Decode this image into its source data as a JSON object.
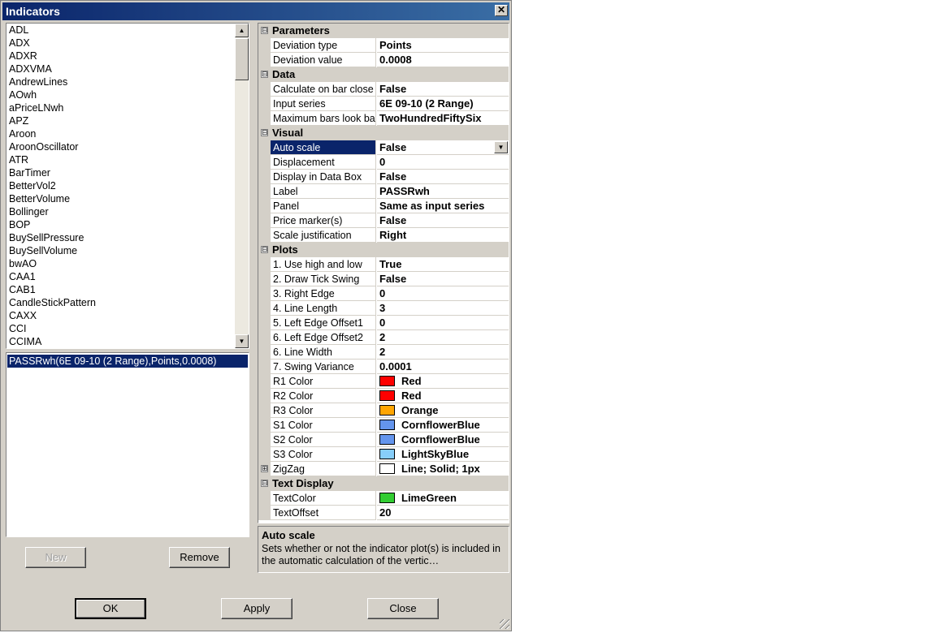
{
  "window": {
    "title": "Indicators",
    "close_glyph": "✕"
  },
  "indicator_list": {
    "items": [
      "ADL",
      "ADX",
      "ADXR",
      "ADXVMA",
      "AndrewLines",
      "AOwh",
      "aPriceLNwh",
      "APZ",
      "Aroon",
      "AroonOscillator",
      "ATR",
      "BarTimer",
      "BetterVol2",
      "BetterVolume",
      "Bollinger",
      "BOP",
      "BuySellPressure",
      "BuySellVolume",
      "bwAO",
      "CAA1",
      "CAB1",
      "CandleStickPattern",
      "CAXX",
      "CCI",
      "CCIMA"
    ]
  },
  "applied_list": {
    "items": [
      "PASSRwh(6E 09-10 (2 Range),Points,0.0008)"
    ]
  },
  "buttons": {
    "new_label": "New",
    "remove_label": "Remove",
    "ok_label": "OK",
    "apply_label": "Apply",
    "close_label": "Close"
  },
  "property_grid": {
    "categories": [
      {
        "name": "Parameters",
        "expander": "⊟",
        "props": [
          {
            "name": "Deviation type",
            "value": "Points"
          },
          {
            "name": "Deviation value",
            "value": "0.0008"
          }
        ]
      },
      {
        "name": "Data",
        "expander": "⊟",
        "props": [
          {
            "name": "Calculate on bar close",
            "value": "False"
          },
          {
            "name": "Input series",
            "value": "6E 09-10 (2 Range)"
          },
          {
            "name": "Maximum bars look back",
            "value": "TwoHundredFiftySix"
          }
        ]
      },
      {
        "name": "Visual",
        "expander": "⊟",
        "props": [
          {
            "name": "Auto scale",
            "value": "False",
            "selected": true
          },
          {
            "name": "Displacement",
            "value": "0"
          },
          {
            "name": "Display in Data Box",
            "value": "False"
          },
          {
            "name": "Label",
            "value": "PASSRwh"
          },
          {
            "name": "Panel",
            "value": "Same as input series"
          },
          {
            "name": "Price marker(s)",
            "value": "False"
          },
          {
            "name": "Scale justification",
            "value": "Right"
          }
        ]
      },
      {
        "name": "Plots",
        "expander": "⊟",
        "props": [
          {
            "name": "1. Use high and low",
            "value": "True"
          },
          {
            "name": "2. Draw Tick Swing",
            "value": "False"
          },
          {
            "name": "3. Right Edge",
            "value": "0"
          },
          {
            "name": "4. Line Length",
            "value": "3"
          },
          {
            "name": "5. Left Edge Offset1",
            "value": "0"
          },
          {
            "name": "6. Left Edge Offset2",
            "value": "2"
          },
          {
            "name": "6. Line Width",
            "value": "2"
          },
          {
            "name": "7. Swing Variance",
            "value": "0.0001"
          },
          {
            "name": "R1 Color",
            "value": "Red",
            "color": "#ff0000"
          },
          {
            "name": "R2 Color",
            "value": "Red",
            "color": "#ff0000"
          },
          {
            "name": "R3 Color",
            "value": "Orange",
            "color": "#ffa500"
          },
          {
            "name": "S1 Color",
            "value": "CornflowerBlue",
            "color": "#6495ed"
          },
          {
            "name": "S2 Color",
            "value": "CornflowerBlue",
            "color": "#6495ed"
          },
          {
            "name": "S3 Color",
            "value": "LightSkyBlue",
            "color": "#87cefa"
          },
          {
            "name": "ZigZag",
            "value": "Line; Solid; 1px",
            "color": "#ffffff",
            "expander": "⊞"
          }
        ]
      },
      {
        "name": "Text Display",
        "expander": "⊟",
        "props": [
          {
            "name": "TextColor",
            "value": "LimeGreen",
            "color": "#32cd32"
          },
          {
            "name": "TextOffset",
            "value": "20"
          }
        ]
      }
    ]
  },
  "description": {
    "title": "Auto scale",
    "text": "Sets whether or not the indicator plot(s) is included in the automatic calculation of the vertic…"
  },
  "scroll": {
    "up_glyph": "▲",
    "down_glyph": "▼",
    "dropdown_glyph": "▼"
  }
}
